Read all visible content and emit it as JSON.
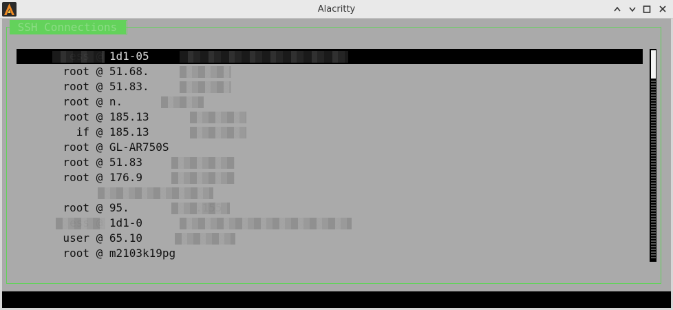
{
  "window": {
    "title": "Alacritty",
    "controls": [
      "chevron-up-icon",
      "minimize-icon",
      "maximize-icon",
      "close-icon"
    ]
  },
  "panel": {
    "title": " SSH Connections "
  },
  "connections": [
    {
      "text": "        ess @ 1d1-05"
    },
    {
      "text": "       root @ 51.68."
    },
    {
      "text": "       root @ 51.83."
    },
    {
      "text": "       root @ n."
    },
    {
      "text": "       root @ 185.13"
    },
    {
      "text": "         if @ 185.13"
    },
    {
      "text": "       root @ GL-AR750S"
    },
    {
      "text": "       root @ 51.83"
    },
    {
      "text": "       root @ 176.9"
    },
    {
      "text": ""
    },
    {
      "text": "       root @ 95.          .155"
    },
    {
      "text": "        ess @ 1d1-0"
    },
    {
      "text": "       user @ 65.10"
    },
    {
      "text": "       root @ m2103k19pg"
    }
  ],
  "colors": {
    "accent_green": "#63d25b",
    "background": "#aaaaaa",
    "selection": "#000000"
  }
}
